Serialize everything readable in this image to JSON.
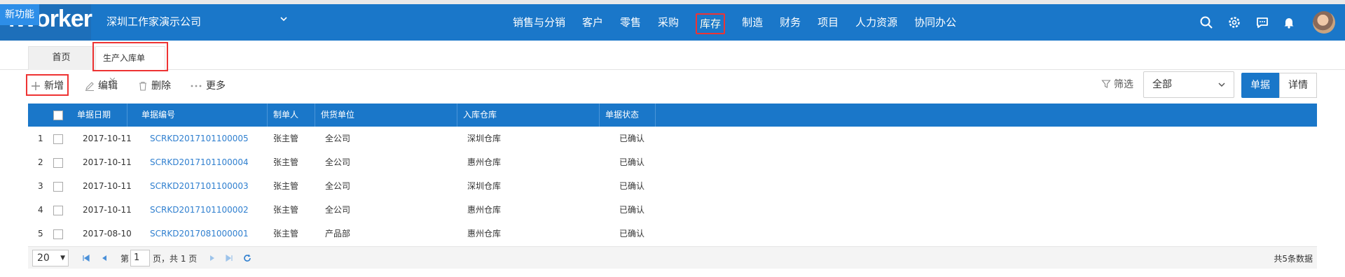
{
  "header": {
    "logo_text": "iWorker",
    "new_feature_label": "新功能",
    "company": "深圳工作家演示公司",
    "nav": [
      "销售与分销",
      "客户",
      "零售",
      "采购",
      "库存",
      "制造",
      "财务",
      "项目",
      "人力资源",
      "协同办公"
    ],
    "active_nav": "库存",
    "icons": [
      "search-icon",
      "gear-icon",
      "chat-icon",
      "bell-icon"
    ],
    "accent_color": "#1a77c9"
  },
  "tabs": {
    "home": "首页",
    "current": "生产入库单",
    "close": "×"
  },
  "toolbar": {
    "add": "新增",
    "edit": "编辑",
    "delete": "删除",
    "more": "更多",
    "filter_label": "筛选",
    "filter_value": "全部",
    "view_doc": "单据",
    "view_detail": "详情"
  },
  "grid": {
    "columns": [
      "单据日期",
      "单据编号",
      "制单人",
      "供货单位",
      "入库仓库",
      "单据状态"
    ],
    "rows": [
      {
        "no": "1",
        "date": "2017-10-11",
        "code": "SCRKD2017101100005",
        "maker": "张主管",
        "supplier": "全公司",
        "warehouse": "深圳仓库",
        "status": "已确认"
      },
      {
        "no": "2",
        "date": "2017-10-11",
        "code": "SCRKD2017101100004",
        "maker": "张主管",
        "supplier": "全公司",
        "warehouse": "惠州仓库",
        "status": "已确认"
      },
      {
        "no": "3",
        "date": "2017-10-11",
        "code": "SCRKD2017101100003",
        "maker": "张主管",
        "supplier": "全公司",
        "warehouse": "深圳仓库",
        "status": "已确认"
      },
      {
        "no": "4",
        "date": "2017-10-11",
        "code": "SCRKD2017101100002",
        "maker": "张主管",
        "supplier": "全公司",
        "warehouse": "惠州仓库",
        "status": "已确认"
      },
      {
        "no": "5",
        "date": "2017-08-10",
        "code": "SCRKD2017081000001",
        "maker": "张主管",
        "supplier": "产品部",
        "warehouse": "惠州仓库",
        "status": "已确认"
      }
    ]
  },
  "pager": {
    "page_size": "20",
    "page_label": "第",
    "page_value": "1",
    "of_label": "页，共 1 页",
    "total": "共5条数据"
  }
}
